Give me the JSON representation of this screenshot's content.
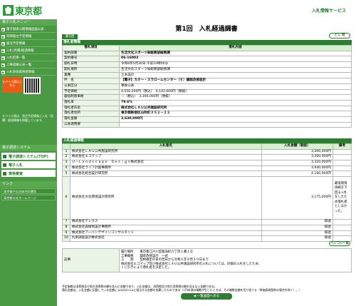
{
  "header": {
    "logo_text": "東京都",
    "service_title": "入札情報サービス"
  },
  "sidebar": {
    "menu_head": "電子入札メニュー",
    "items": [
      {
        "label": "電子調達公開情報画面公表"
      },
      {
        "label": "年間発注予定情報"
      },
      {
        "label": "発注予定情報"
      },
      {
        "label": "入札(見積)経過情報"
      },
      {
        "label": "入札結果一覧"
      },
      {
        "label": "工事成績公表一覧"
      },
      {
        "label": "入札参加資格者情報"
      }
    ],
    "mobile_button": "モバイル版はこちら",
    "mobile_text": "モバイル版は、発注予定情報と入札（見積）経過情報を掲載しています。",
    "system_head": "電子調達システム",
    "system_items": [
      {
        "label": "電子調達システム(TOP)"
      },
      {
        "label": "電子入札"
      },
      {
        "label": "資格審査"
      }
    ],
    "links_head": "リンク",
    "links": [
      {
        "label": "東京電子自治体共同運営"
      },
      {
        "label": "東京都公式ホームページ"
      }
    ]
  },
  "main": {
    "page_title": "第1回　入札経過調書",
    "round_tab": "第1回",
    "close_button": "とじ 閉",
    "info_section": "落札者情報",
    "info_table": {
      "header_label": "落札項目",
      "header_value": "落札内容",
      "rows": [
        {
          "label": "契約部署",
          "value": "生活文化スポーツ局総務部総務課"
        },
        {
          "label": "契約番号",
          "value": "06-16003"
        },
        {
          "label": "開札日時",
          "value": "令和6年5月30日 午前10時00分"
        },
        {
          "label": "開札場所",
          "value": "生活文化スポーツ局総務部総務課"
        },
        {
          "label": "業種",
          "value": "土木設計"
        },
        {
          "label": "件　名",
          "value": "【電子】カヌー・スラロームセンター（６）舗装改修設計"
        },
        {
          "label": "公表区分",
          "value": "事後公表"
        },
        {
          "label": "予定価格",
          "value": "4,556,200円（税込）　4,142,000円（税抜）"
        },
        {
          "label": "最低制限価格",
          "value": "－（税込）　3,300,000円（税抜）"
        },
        {
          "label": "落札率",
          "value": "79.6%"
        },
        {
          "label": "落札者氏名",
          "value": "株式会社ＬＡＵ公共施設研究所"
        },
        {
          "label": "落札者住所",
          "value": "東京都新宿区山吹町３５２－２２"
        },
        {
          "label": "落札金額",
          "value": "3,630,000円"
        },
        {
          "label": "公表適用要",
          "value": ""
        }
      ]
    },
    "bid_section": "入札経過情報",
    "bid_table": {
      "col_name": "入札者名",
      "col_amount": "入札金額（税抜）",
      "col_note": "備考",
      "rows": [
        {
          "num": "1",
          "name": "株式会社ＬＡＵ公共施設研究所",
          "amount": "3,300,000円",
          "note": ""
        },
        {
          "num": "2",
          "name": "株式会社エコマップ",
          "amount": "3,300,000円",
          "note": ""
        },
        {
          "num": "3",
          "name": "Ｕ－Ｌａｎｄｓｃａｐｅ　Ｄｅｓｉｇｎ株式会社",
          "amount": "3,320,000円",
          "note": ""
        },
        {
          "num": "4",
          "name": "株式会社ライフ計画事務所",
          "amount": "3,940,000円",
          "note": ""
        },
        {
          "num": "5",
          "name": "株式会社総合設計研究所",
          "amount": "4,160,000円",
          "note": ""
        },
        {
          "num": "6",
          "name": "株式会社文化環境設計研究所",
          "amount": "3,175,000円",
          "note": "最低制限価格を下回る入札をしたため落札者としなかった。"
        },
        {
          "num": "7",
          "name": "株式会社テレクス",
          "amount": "辞退",
          "note": ""
        },
        {
          "num": "8",
          "name": "株式会社森緑地設計事務所",
          "amount": "辞退",
          "note": ""
        },
        {
          "num": "9",
          "name": "株式会社アーバンデザインコンサルタント",
          "amount": "辞退",
          "note": ""
        },
        {
          "num": "10",
          "name": "丸栄調査設計株式会社",
          "amount": "辞退",
          "note": ""
        }
      ]
    },
    "history_button": "ハンコレ一覧",
    "remarks_label": "記事",
    "remarks_lines": [
      "履行場所　　東京都江戸川区臨海町六丁目１番１号",
      "工事概要　　舗装改修設計　一式",
      "工　　期　　契約確定の日の翌日から令和６年９月３０日まで",
      "株式会社エコマップ及び株式会社ＬＡＵ公共施設研究所の入札については、同価の入札をしたため、",
      "くじ引きにより落札者を決定した。"
    ],
    "footnote_lines": [
      "予定価格は消費税及び地方消費税の額を含んだ金額であり、入札金額は、消費税及び地方消費税の額を含まない金額である。",
      "落札金額は、入札金額に記載している金額に100分の110に相当する金額を加算したものである（1円未満の端数が生じたときは、その端数金額を切り捨てる（単価表現契約の場合を除く）。）"
    ],
    "back_button": "◀ 一覧画面へ戻る"
  }
}
